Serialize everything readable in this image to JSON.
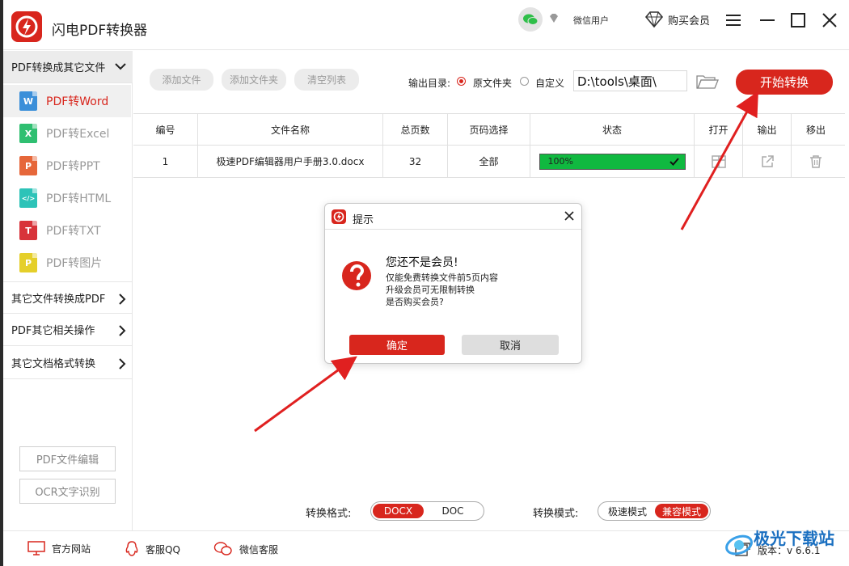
{
  "app": {
    "title": "闪电PDF转换器",
    "wechat_user": "微信用户",
    "buy_vip": "购买会员"
  },
  "sidebar": {
    "group_open": "PDF转换成其它文件",
    "items": [
      {
        "label": "PDF转Word",
        "icon": "W",
        "color": "#3b8fd9"
      },
      {
        "label": "PDF转Excel",
        "icon": "X",
        "color": "#2fbf71"
      },
      {
        "label": "PDF转PPT",
        "icon": "P",
        "color": "#e6673a"
      },
      {
        "label": "PDF转HTML",
        "icon": "</>",
        "color": "#2dc3b8"
      },
      {
        "label": "PDF转TXT",
        "icon": "T",
        "color": "#d8333a"
      },
      {
        "label": "PDF转图片",
        "icon": "P",
        "color": "#e5cf2a"
      }
    ],
    "groups": [
      "其它文件转换成PDF",
      "PDF其它相关操作",
      "其它文档格式转换"
    ],
    "pdf_edit": "PDF文件编辑",
    "ocr": "OCR文字识别"
  },
  "toolbar": {
    "add_file": "添加文件",
    "add_folder": "添加文件夹",
    "clear_list": "清空列表",
    "output_dir_label": "输出目录:",
    "opt_original": "原文件夹",
    "opt_custom": "自定义",
    "output_path": "D:\\tools\\桌面\\",
    "start": "开始转换"
  },
  "table": {
    "headers": [
      "编号",
      "文件名称",
      "总页数",
      "页码选择",
      "状态",
      "打开",
      "输出",
      "移出"
    ],
    "rows": [
      {
        "no": "1",
        "name": "极速PDF编辑器用户手册3.0.docx",
        "pages": "32",
        "range": "全部",
        "status": "100%",
        "progress": 1.0
      }
    ]
  },
  "bottom": {
    "format_label": "转换格式:",
    "formats": [
      "DOCX",
      "DOC"
    ],
    "mode_label": "转换模式:",
    "modes": [
      "极速模式",
      "兼容模式"
    ]
  },
  "footer": {
    "website": "官方网站",
    "qq": "客服QQ",
    "wechat": "微信客服",
    "version": "版本：v 6.6.1"
  },
  "dialog": {
    "title": "提示",
    "heading": "您还不是会员!",
    "lines": [
      "仅能免费转换文件前5页内容",
      "升级会员可无限制转换",
      "是否购买会员?"
    ],
    "ok": "确定",
    "cancel": "取消"
  },
  "watermark": {
    "text": "极光下载站"
  },
  "colors": {
    "accent": "#d8261d",
    "progress": "#10b940"
  }
}
